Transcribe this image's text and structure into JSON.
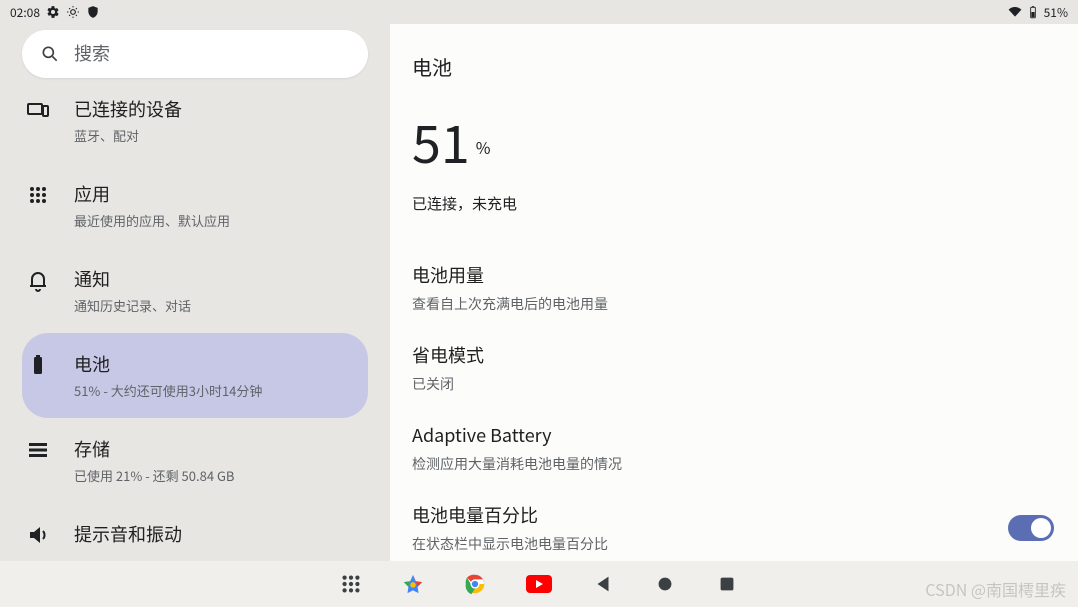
{
  "statusbar": {
    "time": "02:08",
    "battery_text": "51%"
  },
  "search": {
    "placeholder": "搜索"
  },
  "sidebar": {
    "items": [
      {
        "title": "已连接的设备",
        "sub": "蓝牙、配对"
      },
      {
        "title": "应用",
        "sub": "最近使用的应用、默认应用"
      },
      {
        "title": "通知",
        "sub": "通知历史记录、对话"
      },
      {
        "title": "电池",
        "sub": "51% - 大约还可使用3小时14分钟"
      },
      {
        "title": "存储",
        "sub": "已使用 21% - 还剩 50.84 GB"
      },
      {
        "title": "提示音和振动",
        "sub": ""
      }
    ],
    "selected_index": 3
  },
  "detail": {
    "header": "电池",
    "percent_num": "51",
    "percent_symbol": "%",
    "progress_percent": 51,
    "status": "已连接，未充电",
    "rows": [
      {
        "title": "电池用量",
        "sub": "查看自上次充满电后的电池用量"
      },
      {
        "title": "省电模式",
        "sub": "已关闭"
      },
      {
        "title": "Adaptive Battery",
        "sub": "检测应用大量消耗电池电量的情况"
      },
      {
        "title": "电池电量百分比",
        "sub": "在状态栏中显示电池电量百分比",
        "toggle": true,
        "on": true
      }
    ]
  },
  "watermark": "CSDN @南国樗里疾"
}
